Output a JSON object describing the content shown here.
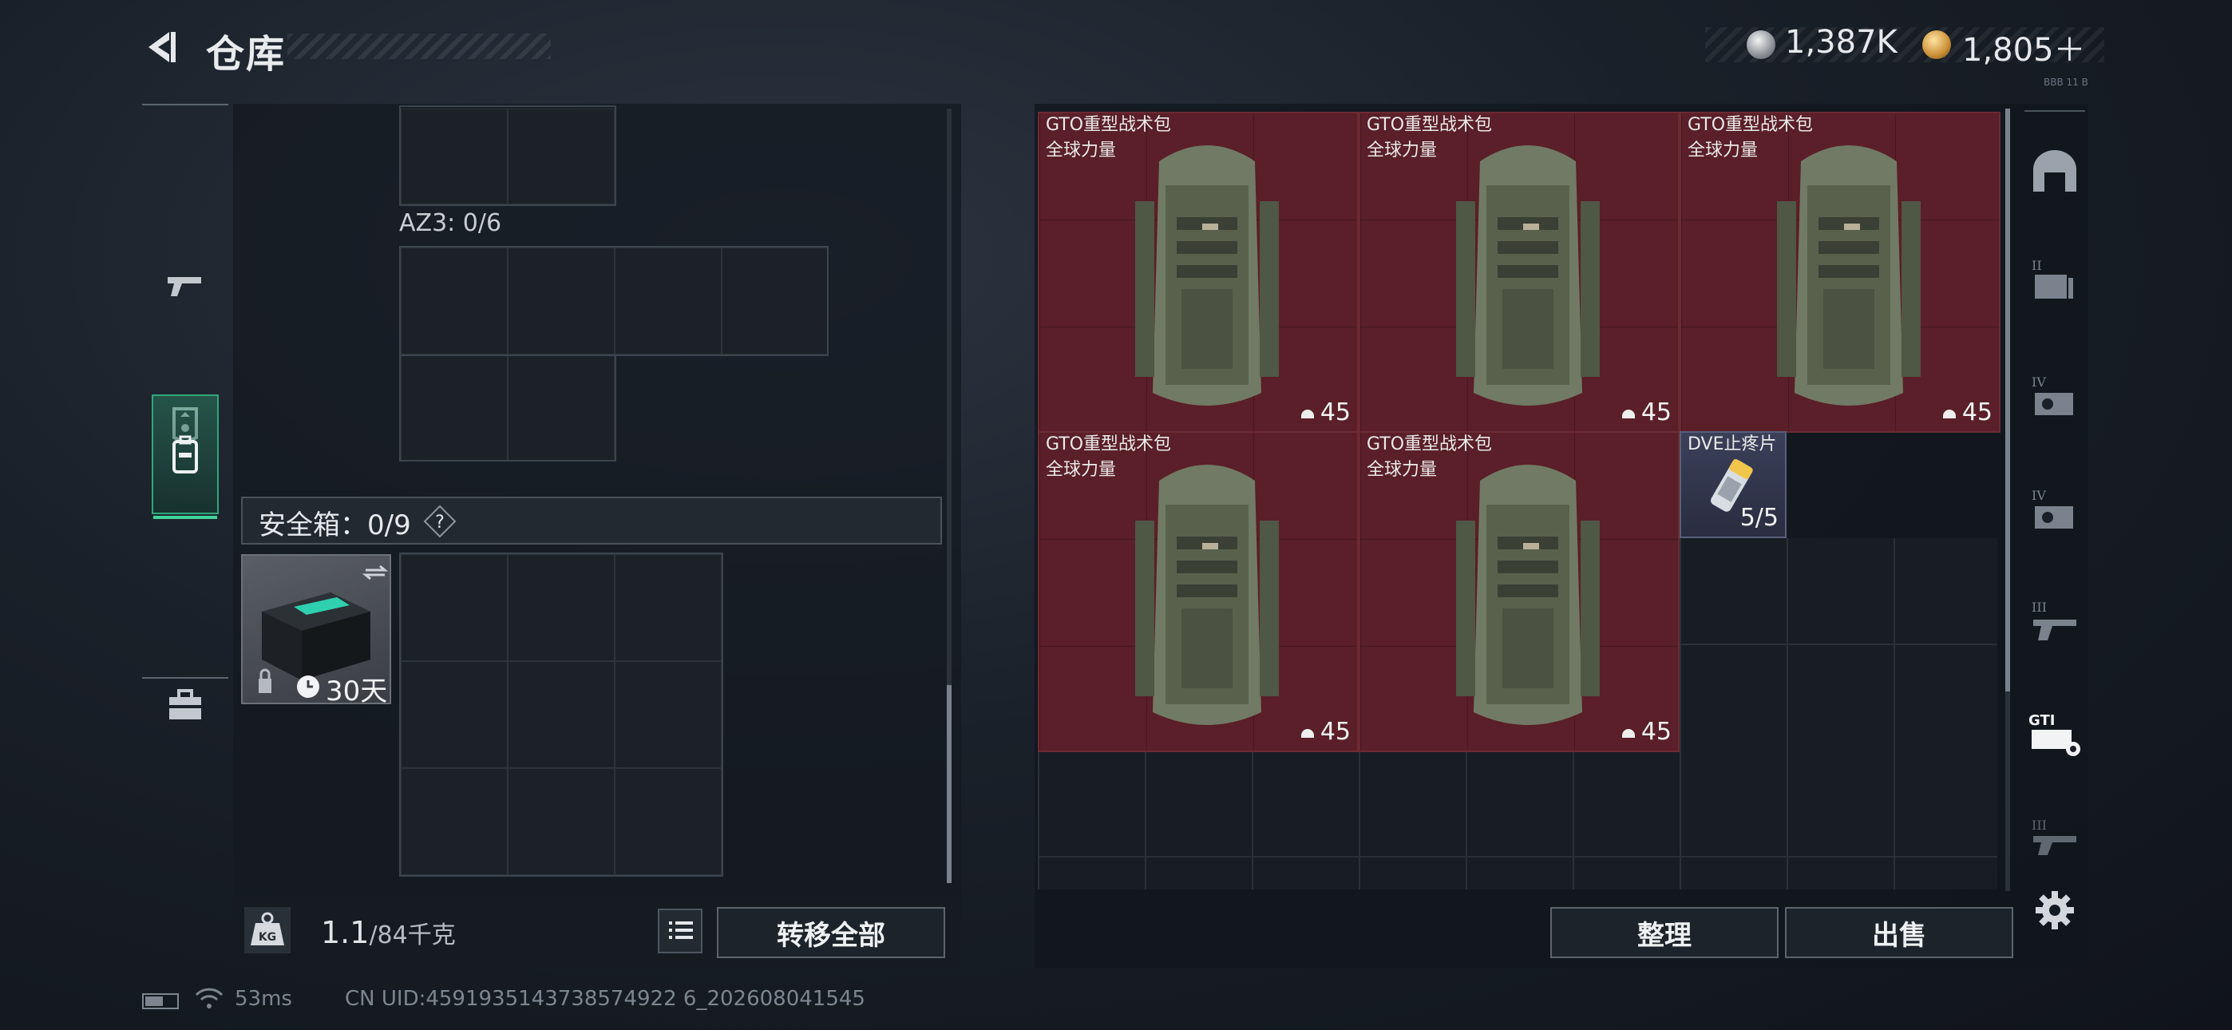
{
  "header": {
    "title": "仓库"
  },
  "currency": {
    "silver": "1,387K",
    "gold": "1,805＋"
  },
  "build_code": "BBB 11 B",
  "rail": {
    "items": [
      "weapon-icon",
      "helmet-icon",
      "backpack-icon",
      "medkit-icon"
    ],
    "active_index": 2
  },
  "left": {
    "az3_label": "AZ3: 0/6",
    "safe_box_label": "安全箱：0/9",
    "safe_box_help": "?",
    "case_days": "30天",
    "weight_value": "1.1",
    "weight_max": "/84千克",
    "transfer_all_label": "转移全部"
  },
  "right": {
    "items": [
      {
        "name": "GTO重型战术包",
        "brand": "全球力量",
        "count": "45"
      },
      {
        "name": "GTO重型战术包",
        "brand": "全球力量",
        "count": "45"
      },
      {
        "name": "GTO重型战术包",
        "brand": "全球力量",
        "count": "45"
      },
      {
        "name": "GTO重型战术包",
        "brand": "全球力量",
        "count": "45"
      },
      {
        "name": "GTO重型战术包",
        "brand": "全球力量",
        "count": "45"
      }
    ],
    "pill": {
      "name": "DVE止疼片",
      "count": "5/5"
    },
    "sort_label": "整理",
    "sell_label": "出售",
    "tabs": [
      "vault-icon",
      "tier-ii-case-icon",
      "tier-iv-armor-icon",
      "tier-iv-armor-icon-2",
      "tier-iii-gun-icon",
      "gti-case-icon",
      "tier-iii-gun-icon-2"
    ],
    "active_tab": 5,
    "tab_tiers": [
      "",
      "II",
      "IV",
      "IV",
      "III",
      "GTI",
      "III"
    ]
  },
  "status": {
    "ping": "53ms",
    "uid": "CN UID:4591935143738574922 6_202608041545"
  },
  "colors": {
    "accent": "#2ea87a",
    "item_red": "#5a1f28",
    "panel": "#141a21"
  }
}
